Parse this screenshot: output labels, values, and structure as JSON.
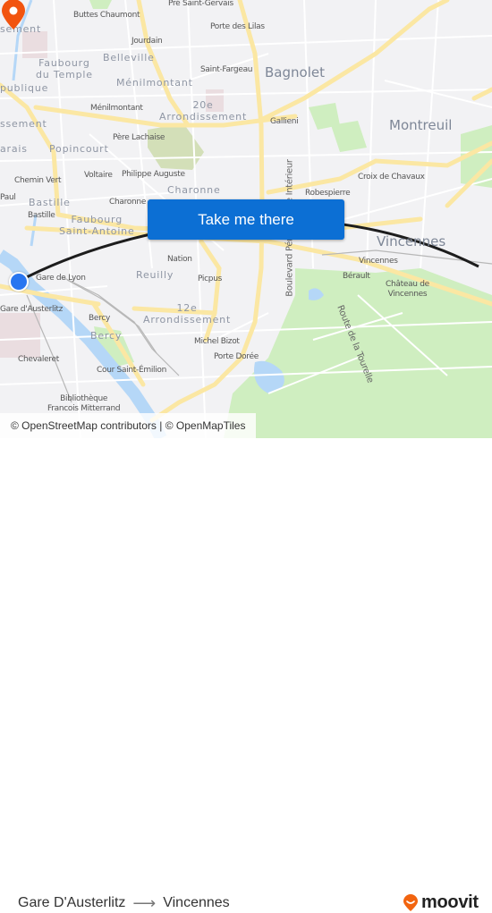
{
  "map": {
    "labels": {
      "buttes_chaumont": "Buttes Chaumont",
      "pre_saint_gervais": "Pré Saint-Gervais",
      "porte_des_lilas": "Porte des Lilas",
      "jourdain": "Jourdain",
      "belleville": "Belleville",
      "faubourg_du_temple": "Faubourg\ndu Temple",
      "menilmontant_district": "Ménilmontant",
      "saint_fargeau": "Saint-Fargeau",
      "menilmontant_station": "Ménilmontant",
      "arrondissement_20": "20e\nArrondissement",
      "gallieni": "Gallieni",
      "bagnolet": "Bagnolet",
      "montreuil": "Montreuil",
      "pere_lachaise": "Père Lachaise",
      "popincourt": "Popincourt",
      "voltaire": "Voltaire",
      "philippe_auguste": "Philippe Auguste",
      "charonne_district": "Charonne",
      "chemin_vert": "Chemin Vert",
      "bastille_district": "Bastille",
      "paul": "Paul",
      "bastille_station": "Bastille",
      "charonne_station": "Charonne",
      "faubourg_saint_antoine": "Faubourg\nSaint-Antoine",
      "croix_de_chavaux": "Croix de Chavaux",
      "robespierre": "Robespierre",
      "boulevard_peripherique": "Boulevard Périphérique Intérieur",
      "vincennes_city": "Vincennes",
      "nation": "Nation",
      "reuilly": "Reuilly",
      "picpus": "Picpus",
      "gare_de_lyon": "Gare de Lyon",
      "gare_austerlitz": "Gare d'Austerlitz",
      "bercy_station": "Bercy",
      "bercy_district": "Bercy",
      "arrondissement_12": "12e\nArrondissement",
      "michel_bizot": "Michel Bizot",
      "porte_doree": "Porte Dorée",
      "chevaleret": "Chevaleret",
      "cour_saint_emilion": "Cour Saint-Émilion",
      "bibliotheque": "Bibliothèque\nFrancois Mitterrand",
      "vincennes_station": "Vincennes",
      "berault": "Bérault",
      "chateau_de_vincennes": "Château de\nVincennes",
      "route_de_la_tourelle": "Route de la Tourelle",
      "arrondissement_partial_1": "sement",
      "republique_partial": "publique",
      "arrondissement_partial_2": "ssement",
      "marais_partial": "arais"
    },
    "attribution": "© OpenStreetMap contributors | © OpenMapTiles",
    "cta_label": "Take me there",
    "colors": {
      "cta": "#0c6fd4",
      "origin_marker": "#2876f0",
      "destination_marker": "#f2540f",
      "route_line": "#1d1d1d",
      "park": "#cfeec0",
      "water": "#b5d7f7",
      "major_road": "#fbe7a3"
    }
  },
  "footer": {
    "origin": "Gare D'Austerlitz",
    "arrow": "⟶",
    "destination": "Vincennes",
    "brand": "moovit",
    "brand_color": "#f2640f"
  }
}
